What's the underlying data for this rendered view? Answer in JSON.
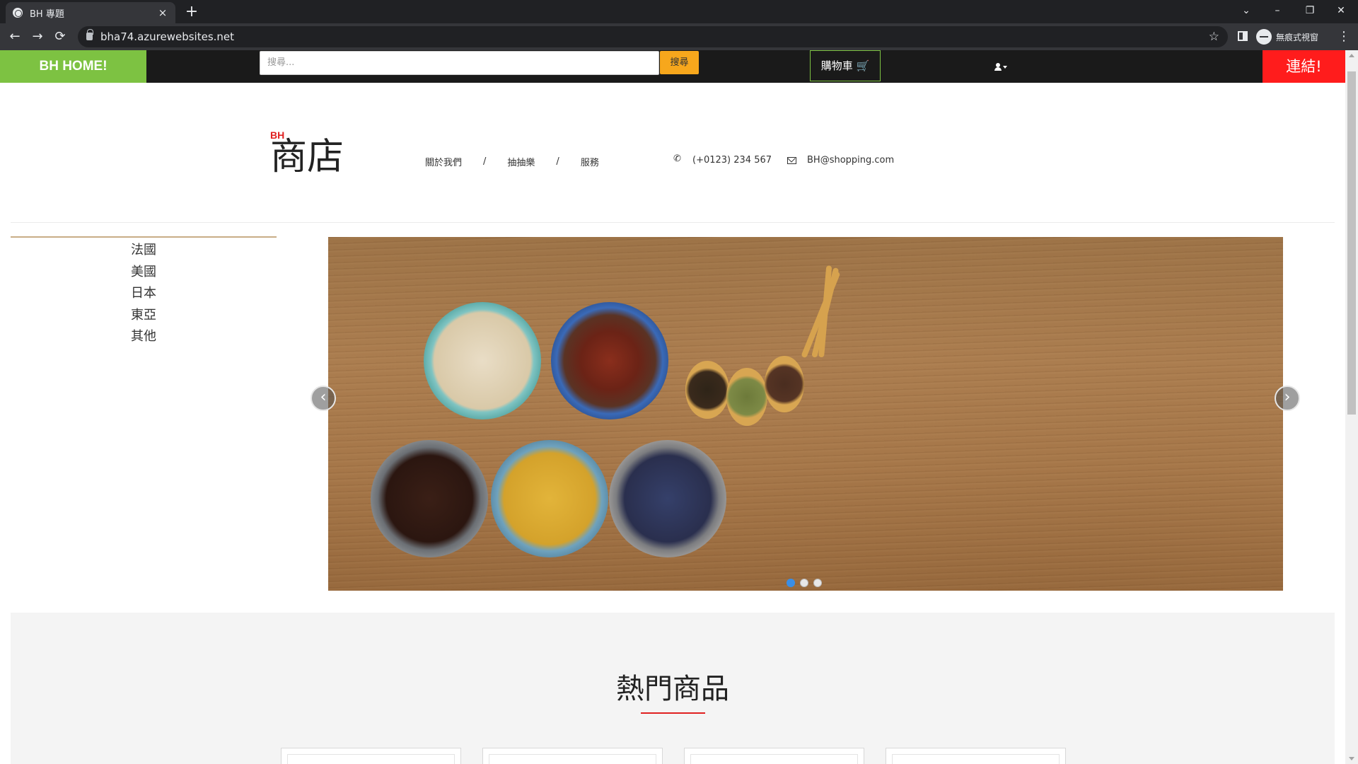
{
  "browser": {
    "tab_title": "BH 專題",
    "tab_close": "×",
    "new_tab": "+",
    "url": "bha74.azurewebsites.net",
    "incognito_label": "無痕式視窗",
    "controls": {
      "back": "←",
      "forward": "→",
      "reload": "⟳",
      "star": "☆",
      "menu": "⋮",
      "minimize": "–",
      "restore": "❐",
      "close": "✕",
      "tab_search": "⌄"
    }
  },
  "topnav": {
    "brand": "BH HOME!",
    "search_placeholder": "搜尋...",
    "search_button": "搜尋",
    "cart_label": "購物車 🛒",
    "connect_button": "連結!"
  },
  "header": {
    "logo_small": "BH",
    "logo_big": "商店",
    "nav": [
      "關於我們",
      "抽抽樂",
      "服務"
    ],
    "nav_separator": "/",
    "phone": "(+0123) 234 567",
    "email": "BH@shopping.com"
  },
  "categories": [
    "法國",
    "美國",
    "日本",
    "東亞",
    "其他"
  ],
  "carousel": {
    "prev": "‹",
    "next": "›",
    "slide_count": 3,
    "active_slide": 1
  },
  "featured": {
    "title": "熱門商品",
    "product_cards": 4
  },
  "colors": {
    "brand_green": "#7dc242",
    "search_orange": "#f7a71c",
    "connect_red": "#ff1c1c",
    "accent_red": "#e02020",
    "nav_dark": "#1a1a1a"
  }
}
